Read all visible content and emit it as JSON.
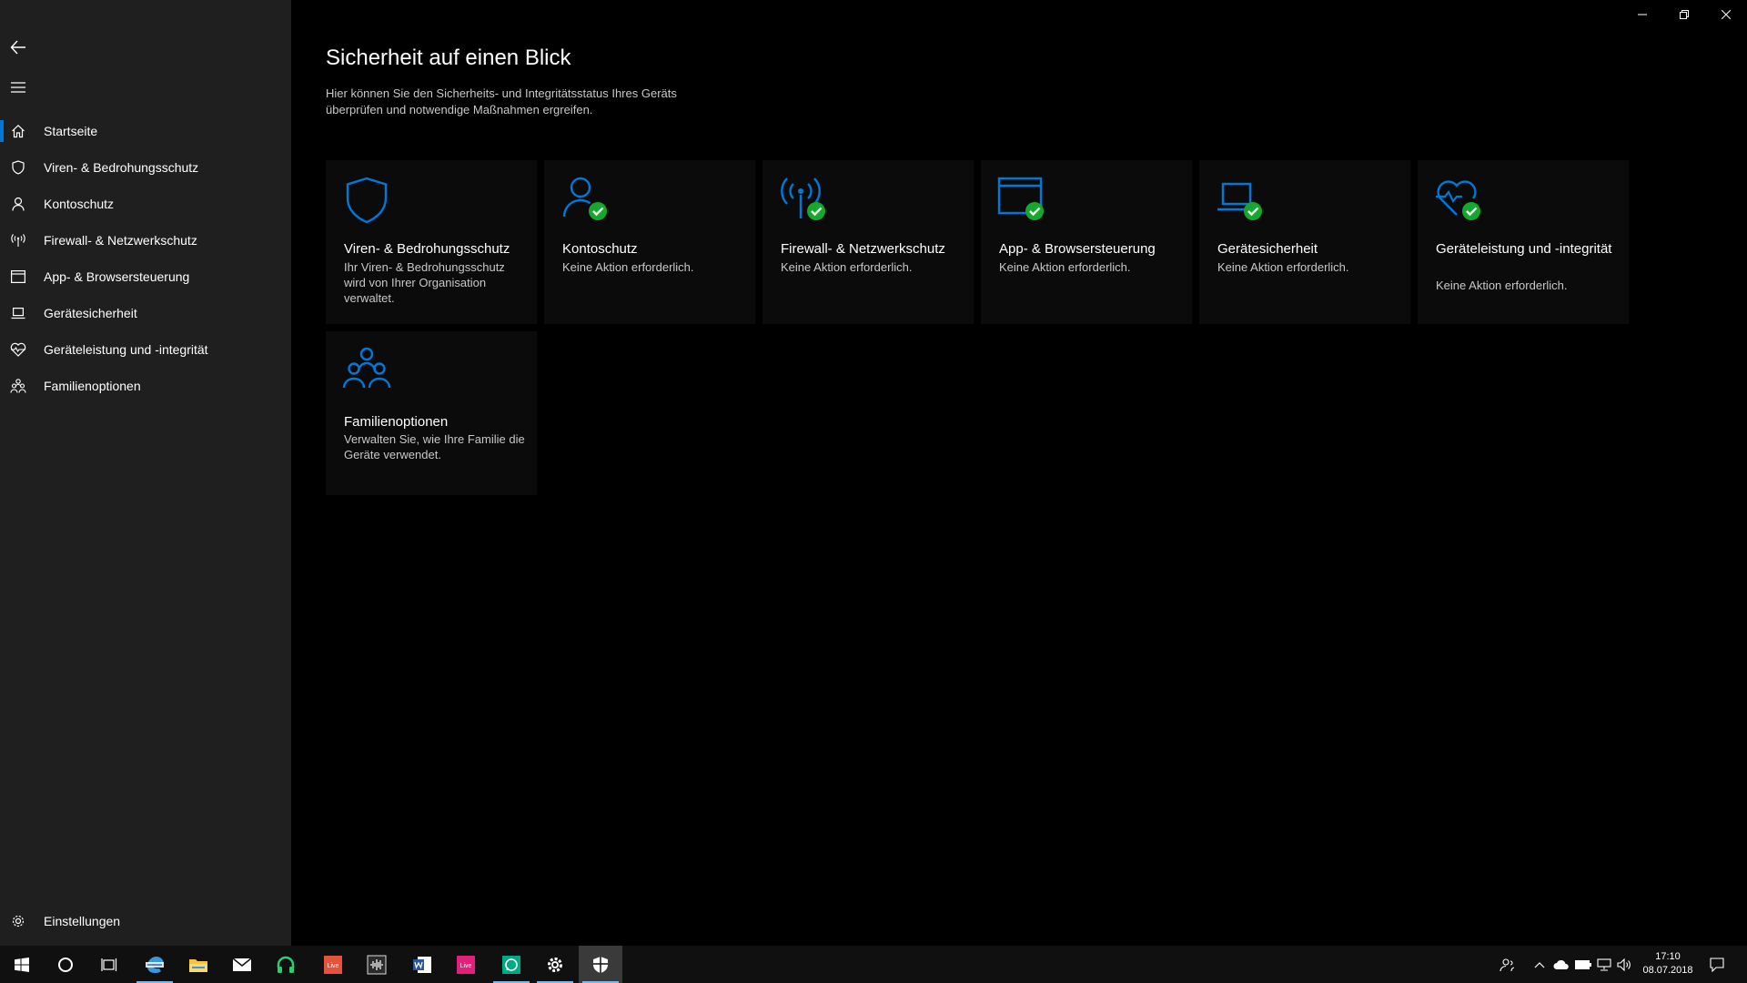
{
  "sidebar": {
    "items": [
      {
        "label": "Startseite",
        "icon": "home-icon"
      },
      {
        "label": "Viren- & Bedrohungsschutz",
        "icon": "shield-icon"
      },
      {
        "label": "Kontoschutz",
        "icon": "person-icon"
      },
      {
        "label": "Firewall- & Netzwerkschutz",
        "icon": "antenna-icon"
      },
      {
        "label": "App- & Browsersteuerung",
        "icon": "browser-window-icon"
      },
      {
        "label": "Gerätesicherheit",
        "icon": "laptop-icon"
      },
      {
        "label": "Geräteleistung und -integrität",
        "icon": "heart-pulse-icon"
      },
      {
        "label": "Familienoptionen",
        "icon": "family-icon"
      }
    ],
    "settings_label": "Einstellungen"
  },
  "main": {
    "title": "Sicherheit auf einen Blick",
    "subtitle": "Hier können Sie den Sicherheits- und Integritätsstatus Ihres Geräts überprüfen und notwendige Maßnahmen ergreifen.",
    "tiles": [
      {
        "title": "Viren- & Bedrohungsschutz",
        "desc": "Ihr Viren- & Bedrohungsschutz wird von Ihrer Organisation verwaltet."
      },
      {
        "title": "Kontoschutz",
        "desc": "Keine Aktion erforderlich."
      },
      {
        "title": "Firewall- & Netzwerkschutz",
        "desc": "Keine Aktion erforderlich."
      },
      {
        "title": "App- & Browsersteuerung",
        "desc": "Keine Aktion erforderlich."
      },
      {
        "title": "Gerätesicherheit",
        "desc": "Keine Aktion erforderlich."
      },
      {
        "title": "Geräteleistung und -integrität",
        "desc": "Keine Aktion erforderlich."
      },
      {
        "title": "Familienoptionen",
        "desc": "Verwalten Sie, wie Ihre Familie die Geräte verwendet."
      }
    ]
  },
  "taskbar": {
    "apps": [
      "windows-start-icon",
      "cortana-icon",
      "task-view-icon",
      "edge-icon",
      "file-explorer-icon",
      "mail-icon",
      "headset-app-icon",
      "live-app-icon",
      "audio-editor-icon",
      "word-icon",
      "live-app-pink-icon",
      "whatsapp-icon",
      "settings-gear-icon",
      "windows-security-icon"
    ],
    "live_label": "Live",
    "time": "17:10",
    "date": "08.07.2018"
  },
  "colors": {
    "accent": "#0078d7",
    "ok_green": "#16a82c",
    "sidebar_bg": "#1f1f1f",
    "tile_bg": "#0b0b0b"
  }
}
